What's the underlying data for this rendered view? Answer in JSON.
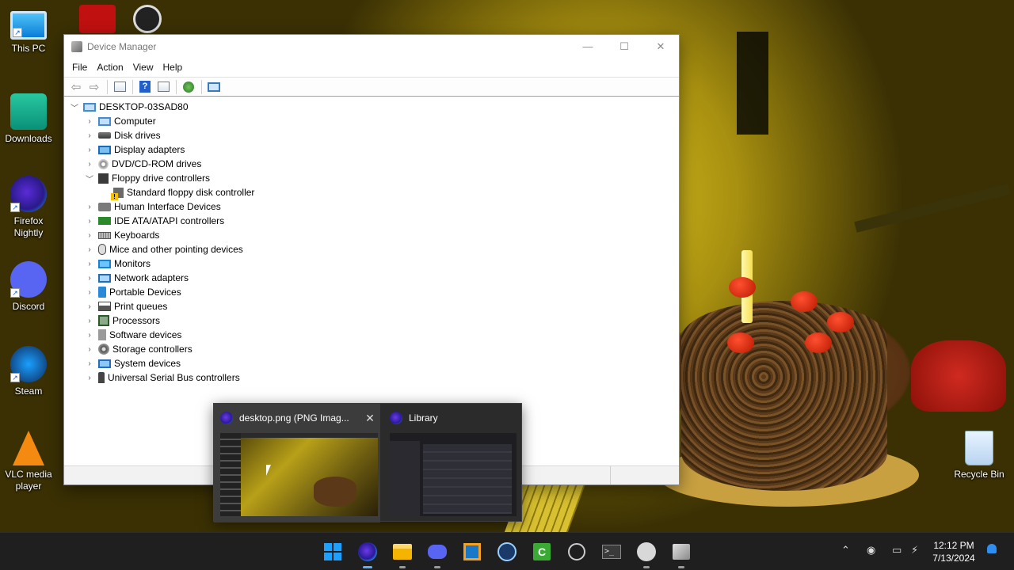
{
  "desktop": {
    "icons": [
      {
        "label": "This PC",
        "icon": "this-pc-icon"
      },
      {
        "label": "Downloads",
        "icon": "downloads-folder-icon"
      },
      {
        "label": "Firefox Nightly",
        "icon": "firefox-nightly-icon"
      },
      {
        "label": "Discord",
        "icon": "discord-icon"
      },
      {
        "label": "Steam",
        "icon": "steam-icon"
      },
      {
        "label": "VLC media player",
        "icon": "vlc-icon"
      }
    ],
    "recycle_bin": {
      "label": "Recycle Bin",
      "icon": "recycle-bin-icon"
    }
  },
  "window": {
    "title": "Device Manager",
    "controls": {
      "minimize": "—",
      "maximize": "☐",
      "close": "✕"
    },
    "menu": [
      "File",
      "Action",
      "View",
      "Help"
    ],
    "tree": {
      "root": {
        "label": "DESKTOP-03SAD80",
        "expanded": true
      },
      "categories": [
        {
          "label": "Computer",
          "icon": "computer-icon",
          "expanded": false
        },
        {
          "label": "Disk drives",
          "icon": "disk-drive-icon",
          "expanded": false
        },
        {
          "label": "Display adapters",
          "icon": "display-adapter-icon",
          "expanded": false
        },
        {
          "label": "DVD/CD-ROM drives",
          "icon": "dvd-drive-icon",
          "expanded": false
        },
        {
          "label": "Floppy drive controllers",
          "icon": "floppy-controller-icon",
          "expanded": true,
          "children": [
            {
              "label": "Standard floppy disk controller",
              "icon": "warning-device-icon"
            }
          ]
        },
        {
          "label": "Human Interface Devices",
          "icon": "hid-icon",
          "expanded": false
        },
        {
          "label": "IDE ATA/ATAPI controllers",
          "icon": "ide-controller-icon",
          "expanded": false
        },
        {
          "label": "Keyboards",
          "icon": "keyboard-icon",
          "expanded": false
        },
        {
          "label": "Mice and other pointing devices",
          "icon": "mouse-icon",
          "expanded": false
        },
        {
          "label": "Monitors",
          "icon": "monitor-icon",
          "expanded": false
        },
        {
          "label": "Network adapters",
          "icon": "network-adapter-icon",
          "expanded": false
        },
        {
          "label": "Portable Devices",
          "icon": "portable-device-icon",
          "expanded": false
        },
        {
          "label": "Print queues",
          "icon": "printer-icon",
          "expanded": false
        },
        {
          "label": "Processors",
          "icon": "processor-icon",
          "expanded": false
        },
        {
          "label": "Software devices",
          "icon": "software-device-icon",
          "expanded": false
        },
        {
          "label": "Storage controllers",
          "icon": "storage-controller-icon",
          "expanded": false
        },
        {
          "label": "System devices",
          "icon": "system-device-icon",
          "expanded": false
        },
        {
          "label": "Universal Serial Bus controllers",
          "icon": "usb-icon",
          "expanded": false
        }
      ]
    }
  },
  "thumbnails": [
    {
      "title": "desktop.png (PNG Imag...",
      "close": "✕"
    },
    {
      "title": "Library"
    }
  ],
  "taskbar": {
    "apps": [
      "start-icon",
      "firefox-icon",
      "file-explorer-icon",
      "discord-icon",
      "virtualbox-icon",
      "steam-icon",
      "green-app-icon",
      "obs-icon",
      "terminal-icon",
      "steam-alt-icon",
      "device-manager-icon"
    ],
    "active_app": "firefox-icon",
    "terminal_glyph": ">_",
    "green_app_glyph": "C",
    "tray": {
      "chevron": "⌃",
      "discord": "◉",
      "display": "▭",
      "network": "⚡"
    },
    "clock": {
      "time": "12:12 PM",
      "date": "7/13/2024"
    }
  },
  "colors": {
    "accent": "#5fb2f2",
    "taskbar_bg": "#1f1f1f",
    "warning": "#f6c000"
  }
}
